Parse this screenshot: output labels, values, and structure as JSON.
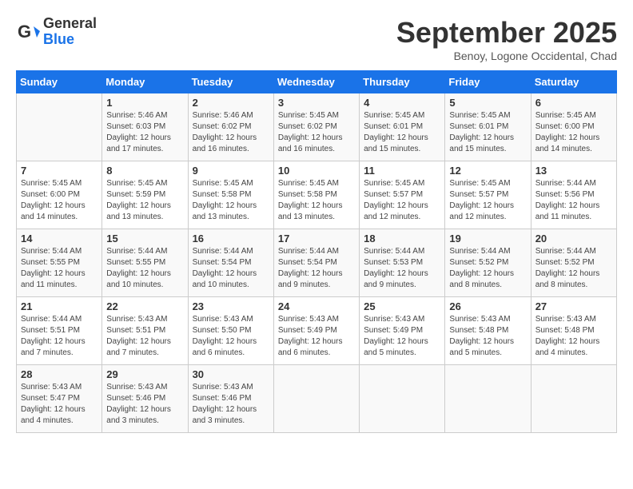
{
  "header": {
    "logo_general": "General",
    "logo_blue": "Blue",
    "month_title": "September 2025",
    "subtitle": "Benoy, Logone Occidental, Chad"
  },
  "weekdays": [
    "Sunday",
    "Monday",
    "Tuesday",
    "Wednesday",
    "Thursday",
    "Friday",
    "Saturday"
  ],
  "weeks": [
    [
      {
        "day": "",
        "sunrise": "",
        "sunset": "",
        "daylight": ""
      },
      {
        "day": "1",
        "sunrise": "Sunrise: 5:46 AM",
        "sunset": "Sunset: 6:03 PM",
        "daylight": "Daylight: 12 hours and 17 minutes."
      },
      {
        "day": "2",
        "sunrise": "Sunrise: 5:46 AM",
        "sunset": "Sunset: 6:02 PM",
        "daylight": "Daylight: 12 hours and 16 minutes."
      },
      {
        "day": "3",
        "sunrise": "Sunrise: 5:45 AM",
        "sunset": "Sunset: 6:02 PM",
        "daylight": "Daylight: 12 hours and 16 minutes."
      },
      {
        "day": "4",
        "sunrise": "Sunrise: 5:45 AM",
        "sunset": "Sunset: 6:01 PM",
        "daylight": "Daylight: 12 hours and 15 minutes."
      },
      {
        "day": "5",
        "sunrise": "Sunrise: 5:45 AM",
        "sunset": "Sunset: 6:01 PM",
        "daylight": "Daylight: 12 hours and 15 minutes."
      },
      {
        "day": "6",
        "sunrise": "Sunrise: 5:45 AM",
        "sunset": "Sunset: 6:00 PM",
        "daylight": "Daylight: 12 hours and 14 minutes."
      }
    ],
    [
      {
        "day": "7",
        "sunrise": "Sunrise: 5:45 AM",
        "sunset": "Sunset: 6:00 PM",
        "daylight": "Daylight: 12 hours and 14 minutes."
      },
      {
        "day": "8",
        "sunrise": "Sunrise: 5:45 AM",
        "sunset": "Sunset: 5:59 PM",
        "daylight": "Daylight: 12 hours and 13 minutes."
      },
      {
        "day": "9",
        "sunrise": "Sunrise: 5:45 AM",
        "sunset": "Sunset: 5:58 PM",
        "daylight": "Daylight: 12 hours and 13 minutes."
      },
      {
        "day": "10",
        "sunrise": "Sunrise: 5:45 AM",
        "sunset": "Sunset: 5:58 PM",
        "daylight": "Daylight: 12 hours and 13 minutes."
      },
      {
        "day": "11",
        "sunrise": "Sunrise: 5:45 AM",
        "sunset": "Sunset: 5:57 PM",
        "daylight": "Daylight: 12 hours and 12 minutes."
      },
      {
        "day": "12",
        "sunrise": "Sunrise: 5:45 AM",
        "sunset": "Sunset: 5:57 PM",
        "daylight": "Daylight: 12 hours and 12 minutes."
      },
      {
        "day": "13",
        "sunrise": "Sunrise: 5:44 AM",
        "sunset": "Sunset: 5:56 PM",
        "daylight": "Daylight: 12 hours and 11 minutes."
      }
    ],
    [
      {
        "day": "14",
        "sunrise": "Sunrise: 5:44 AM",
        "sunset": "Sunset: 5:55 PM",
        "daylight": "Daylight: 12 hours and 11 minutes."
      },
      {
        "day": "15",
        "sunrise": "Sunrise: 5:44 AM",
        "sunset": "Sunset: 5:55 PM",
        "daylight": "Daylight: 12 hours and 10 minutes."
      },
      {
        "day": "16",
        "sunrise": "Sunrise: 5:44 AM",
        "sunset": "Sunset: 5:54 PM",
        "daylight": "Daylight: 12 hours and 10 minutes."
      },
      {
        "day": "17",
        "sunrise": "Sunrise: 5:44 AM",
        "sunset": "Sunset: 5:54 PM",
        "daylight": "Daylight: 12 hours and 9 minutes."
      },
      {
        "day": "18",
        "sunrise": "Sunrise: 5:44 AM",
        "sunset": "Sunset: 5:53 PM",
        "daylight": "Daylight: 12 hours and 9 minutes."
      },
      {
        "day": "19",
        "sunrise": "Sunrise: 5:44 AM",
        "sunset": "Sunset: 5:52 PM",
        "daylight": "Daylight: 12 hours and 8 minutes."
      },
      {
        "day": "20",
        "sunrise": "Sunrise: 5:44 AM",
        "sunset": "Sunset: 5:52 PM",
        "daylight": "Daylight: 12 hours and 8 minutes."
      }
    ],
    [
      {
        "day": "21",
        "sunrise": "Sunrise: 5:44 AM",
        "sunset": "Sunset: 5:51 PM",
        "daylight": "Daylight: 12 hours and 7 minutes."
      },
      {
        "day": "22",
        "sunrise": "Sunrise: 5:43 AM",
        "sunset": "Sunset: 5:51 PM",
        "daylight": "Daylight: 12 hours and 7 minutes."
      },
      {
        "day": "23",
        "sunrise": "Sunrise: 5:43 AM",
        "sunset": "Sunset: 5:50 PM",
        "daylight": "Daylight: 12 hours and 6 minutes."
      },
      {
        "day": "24",
        "sunrise": "Sunrise: 5:43 AM",
        "sunset": "Sunset: 5:49 PM",
        "daylight": "Daylight: 12 hours and 6 minutes."
      },
      {
        "day": "25",
        "sunrise": "Sunrise: 5:43 AM",
        "sunset": "Sunset: 5:49 PM",
        "daylight": "Daylight: 12 hours and 5 minutes."
      },
      {
        "day": "26",
        "sunrise": "Sunrise: 5:43 AM",
        "sunset": "Sunset: 5:48 PM",
        "daylight": "Daylight: 12 hours and 5 minutes."
      },
      {
        "day": "27",
        "sunrise": "Sunrise: 5:43 AM",
        "sunset": "Sunset: 5:48 PM",
        "daylight": "Daylight: 12 hours and 4 minutes."
      }
    ],
    [
      {
        "day": "28",
        "sunrise": "Sunrise: 5:43 AM",
        "sunset": "Sunset: 5:47 PM",
        "daylight": "Daylight: 12 hours and 4 minutes."
      },
      {
        "day": "29",
        "sunrise": "Sunrise: 5:43 AM",
        "sunset": "Sunset: 5:46 PM",
        "daylight": "Daylight: 12 hours and 3 minutes."
      },
      {
        "day": "30",
        "sunrise": "Sunrise: 5:43 AM",
        "sunset": "Sunset: 5:46 PM",
        "daylight": "Daylight: 12 hours and 3 minutes."
      },
      {
        "day": "",
        "sunrise": "",
        "sunset": "",
        "daylight": ""
      },
      {
        "day": "",
        "sunrise": "",
        "sunset": "",
        "daylight": ""
      },
      {
        "day": "",
        "sunrise": "",
        "sunset": "",
        "daylight": ""
      },
      {
        "day": "",
        "sunrise": "",
        "sunset": "",
        "daylight": ""
      }
    ]
  ]
}
